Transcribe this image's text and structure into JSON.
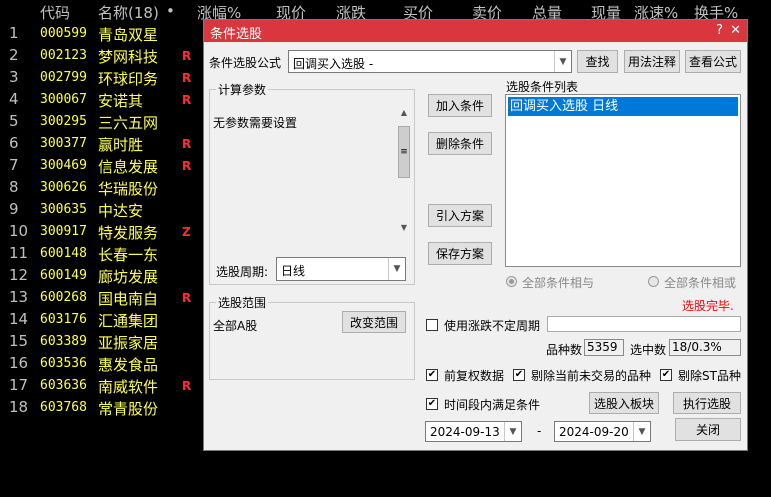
{
  "table": {
    "headers": [
      "代码",
      "名称(18)",
      "•",
      "涨幅%",
      "现价",
      "涨跌",
      "买价",
      "卖价",
      "总量",
      "现量",
      "涨速%",
      "换手%"
    ],
    "rows": [
      {
        "n": "1",
        "code": "000599",
        "name": "青岛双星",
        "flag": ""
      },
      {
        "n": "2",
        "code": "002123",
        "name": "梦网科技",
        "flag": "R"
      },
      {
        "n": "3",
        "code": "002799",
        "name": "环球印务",
        "flag": "R"
      },
      {
        "n": "4",
        "code": "300067",
        "name": "安诺其",
        "flag": "R"
      },
      {
        "n": "5",
        "code": "300295",
        "name": "三六五网",
        "flag": ""
      },
      {
        "n": "6",
        "code": "300377",
        "name": "赢时胜",
        "flag": "R"
      },
      {
        "n": "7",
        "code": "300469",
        "name": "信息发展",
        "flag": "R"
      },
      {
        "n": "8",
        "code": "300626",
        "name": "华瑞股份",
        "flag": ""
      },
      {
        "n": "9",
        "code": "300635",
        "name": "中达安",
        "flag": ""
      },
      {
        "n": "10",
        "code": "300917",
        "name": "特发服务",
        "flag": "Z"
      },
      {
        "n": "11",
        "code": "600148",
        "name": "长春一东",
        "flag": ""
      },
      {
        "n": "12",
        "code": "600149",
        "name": "廊坊发展",
        "flag": ""
      },
      {
        "n": "13",
        "code": "600268",
        "name": "国电南自",
        "flag": "R"
      },
      {
        "n": "14",
        "code": "603176",
        "name": "汇通集团",
        "flag": ""
      },
      {
        "n": "15",
        "code": "603389",
        "name": "亚振家居",
        "flag": ""
      },
      {
        "n": "16",
        "code": "603536",
        "name": "惠发食品",
        "flag": ""
      },
      {
        "n": "17",
        "code": "603636",
        "name": "南威软件",
        "flag": "R"
      },
      {
        "n": "18",
        "code": "603768",
        "name": "常青股份",
        "flag": ""
      }
    ]
  },
  "dialog": {
    "title": "条件选股",
    "formula_label": "条件选股公式",
    "formula_value": "回调买入选股 -",
    "btn_find": "查找",
    "btn_syntax": "用法注释",
    "btn_view": "查看公式",
    "params_title": "计算参数",
    "params_text": "无参数需要设置",
    "period_label": "选股周期:",
    "period_value": "日线",
    "btn_add": "加入条件",
    "btn_delete": "删除条件",
    "btn_import": "引入方案",
    "btn_save": "保存方案",
    "list_title": "选股条件列表",
    "list_items": [
      "回调买入选股  日线"
    ],
    "radio_and": "全部条件相与",
    "radio_or": "全部条件相或",
    "status": "选股完毕.",
    "range_title": "选股范围",
    "range_value": "全部A股",
    "btn_change_range": "改变范围",
    "use_period_label": "使用涨跌不定周期",
    "count_label": "品种数",
    "count_value": "5359",
    "selected_label": "选中数",
    "selected_value": "18/0.3%",
    "chk_adjust": "前复权数据",
    "chk_exclude_untraded": "剔除当前未交易的品种",
    "chk_exclude_st": "剔除ST品种",
    "chk_timespan": "时间段内满足条件",
    "btn_to_block": "选股入板块",
    "btn_execute": "执行选股",
    "date_from": "2024-09-13",
    "date_to": "2024-09-20",
    "dash": "-",
    "btn_close": "关闭",
    "colors": {
      "title_bar": "#d9363e",
      "selected": "#0078d7",
      "status": "#ff0000"
    }
  }
}
